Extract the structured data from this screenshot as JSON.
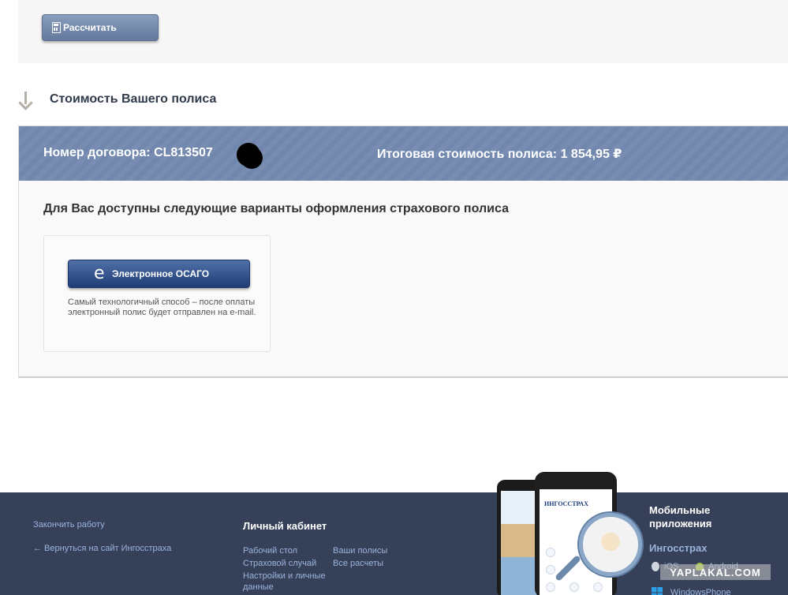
{
  "calc": {
    "button_label": "Рассчитать"
  },
  "section": {
    "title": "Стоимость Вашего полиса"
  },
  "result": {
    "contract_label": "Номер договора: CL813507",
    "total_label": "Итоговая стоимость полиса: 1 854,95 ₽",
    "options_title": "Для Вас доступны следующие варианты оформления страхового полиса",
    "option": {
      "icon_glyph": "e",
      "button_label": "Электронное ОСАГО",
      "description": "Самый технологичный способ – после оплаты электронный полис будет отправлен на e-mail."
    }
  },
  "footer": {
    "logout": "Закончить работу",
    "back_link": "← Вернуться на сайт Ингосстраха",
    "cabinet_title": "Личный кабинет",
    "cabinet_links_left": [
      "Рабочий стол",
      "Страховой случай",
      "Настройки и личные данные"
    ],
    "cabinet_links_right": [
      "Ваши полисы",
      "Все расчеты"
    ],
    "mobile_title": "Мобильные приложения",
    "app_name": "Ингосстрах",
    "app_logo": "ИНГОССТРАХ",
    "os": [
      "iOS",
      "Android",
      "WindowsPhone"
    ]
  },
  "watermark": "YAPLAKAL.COM",
  "colors": {
    "header_bg": "#7187ad",
    "footer_bg": "#364159",
    "primary_button": "#1f3d77",
    "link": "#9bb3dc"
  }
}
